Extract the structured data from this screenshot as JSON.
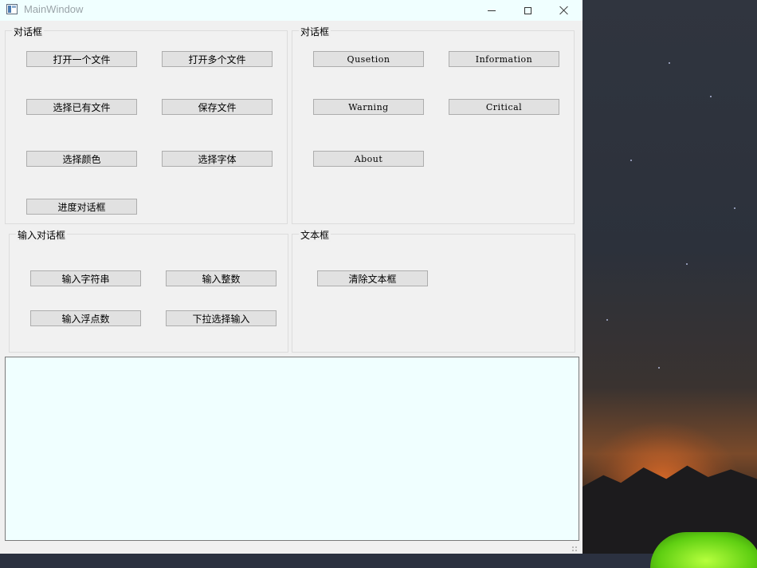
{
  "window": {
    "title": "MainWindow"
  },
  "groups": {
    "file_dialogs": {
      "title": "对话框",
      "open_file": "打开一个文件",
      "open_files": "打开多个文件",
      "select_existing": "选择已有文件",
      "save_file": "保存文件",
      "select_color": "选择颜色",
      "select_font": "选择字体",
      "progress_dialog": "进度对话框"
    },
    "message_boxes": {
      "title": "对话框",
      "question": "Qusetion",
      "information": "Information",
      "warning": "Warning",
      "critical": "Critical",
      "about": "About"
    },
    "input_dialogs": {
      "title": "输入对话框",
      "input_string": "输入字符串",
      "input_integer": "输入整数",
      "input_float": "输入浮点数",
      "dropdown_input": "下拉选择输入"
    },
    "textbox": {
      "title": "文本框",
      "clear_text": "清除文本框"
    }
  },
  "text_area": {
    "value": ""
  },
  "colors": {
    "titlebar_bg": "#f0ffff",
    "window_bg": "#f0f0f0",
    "textarea_bg": "#f0ffff",
    "button_bg": "#e1e1e1"
  },
  "icons": {
    "app": "app-window-icon",
    "minimize": "minimize-icon",
    "maximize": "maximize-icon",
    "close": "close-icon"
  }
}
